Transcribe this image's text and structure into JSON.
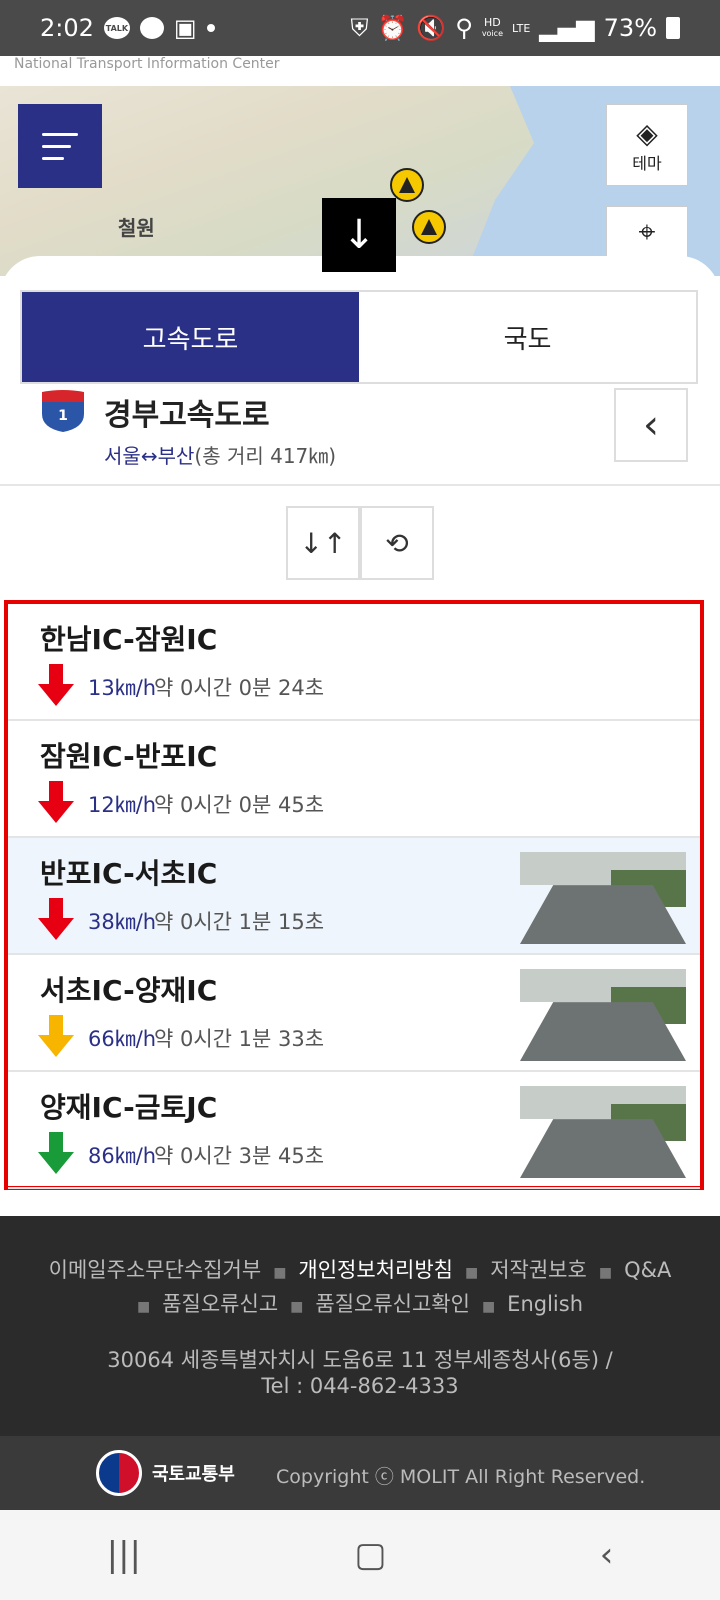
{
  "status_bar": {
    "time": "2:02",
    "talk_label": "TALK",
    "net_hd": "HD",
    "net_voice": "voice",
    "net_lte": "LTE",
    "battery": "73%"
  },
  "brand_strip": "National Transport Information Center",
  "map": {
    "city_label": "철원",
    "theme_label": "테마"
  },
  "tabs": [
    {
      "label": "고속도로",
      "active": true
    },
    {
      "label": "국도",
      "active": false
    }
  ],
  "road": {
    "number": "1",
    "name": "경부고속도로",
    "from": "서울",
    "arrow": "↔",
    "to": "부산",
    "distance": "(총 거리 417㎞)"
  },
  "segments": [
    {
      "name": "한남IC-잠원IC",
      "speed": "13㎞/h",
      "time": "약 0시간 0분 24초",
      "level": "red",
      "has_cctv": false
    },
    {
      "name": "잠원IC-반포IC",
      "speed": "12㎞/h",
      "time": "약 0시간 0분 45초",
      "level": "red",
      "has_cctv": false
    },
    {
      "name": "반포IC-서초IC",
      "speed": "38㎞/h",
      "time": "약 0시간 1분 15초",
      "level": "red",
      "has_cctv": true
    },
    {
      "name": "서초IC-양재IC",
      "speed": "66㎞/h",
      "time": "약 0시간 1분 33초",
      "level": "yellow",
      "has_cctv": true
    },
    {
      "name": "양재IC-금토JC",
      "speed": "86㎞/h",
      "time": "약 0시간 3분 45초",
      "level": "green",
      "has_cctv": true
    }
  ],
  "colors": {
    "red": "#e60012",
    "yellow": "#f7b500",
    "green": "#1a9b3a",
    "accent": "#2b3087"
  },
  "footer": {
    "link_email": "이메일주소무단수집거부",
    "link_privacy": "개인정보처리방침",
    "link_copyright": "저작권보호",
    "link_qa": "Q&A",
    "link_quality": "품질오류신고",
    "link_quality_check": "품질오류신고확인",
    "link_english": "English",
    "address": "30064 세종특별자치시 도움6로 11 정부세종청사(6동) /",
    "tel": "Tel : 044-862-4333",
    "ministry": "국토교통부",
    "copyright": "Copyright ⓒ MOLIT All Right Reserved."
  }
}
